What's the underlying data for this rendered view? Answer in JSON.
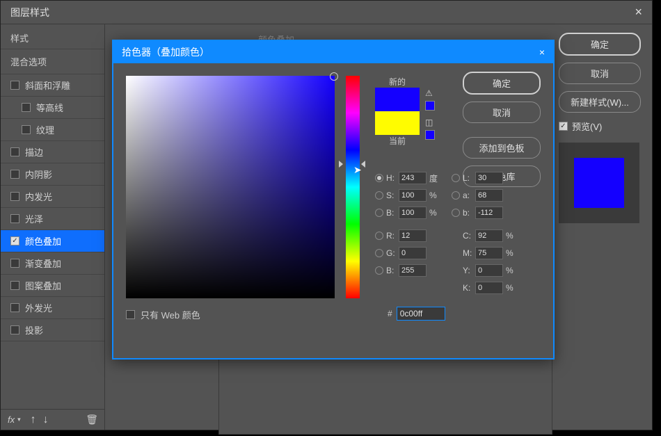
{
  "dialog": {
    "title": "图层样式"
  },
  "sidebar": {
    "head": "样式",
    "sub": "混合选项",
    "items": [
      {
        "label": "斜面和浮雕",
        "checked": false,
        "indent": false
      },
      {
        "label": "等高线",
        "checked": false,
        "indent": true
      },
      {
        "label": "纹理",
        "checked": false,
        "indent": true
      },
      {
        "label": "描边",
        "checked": false,
        "indent": false
      },
      {
        "label": "内阴影",
        "checked": false,
        "indent": false
      },
      {
        "label": "内发光",
        "checked": false,
        "indent": false
      },
      {
        "label": "光泽",
        "checked": false,
        "indent": false
      },
      {
        "label": "颜色叠加",
        "checked": true,
        "indent": false,
        "active": true
      },
      {
        "label": "渐变叠加",
        "checked": false,
        "indent": false
      },
      {
        "label": "图案叠加",
        "checked": false,
        "indent": false
      },
      {
        "label": "外发光",
        "checked": false,
        "indent": false
      },
      {
        "label": "投影",
        "checked": false,
        "indent": false
      }
    ]
  },
  "faded_header": "颜色叠加",
  "right": {
    "ok": "确定",
    "cancel": "取消",
    "newstyle": "新建样式(W)...",
    "preview": "预览(V)"
  },
  "bottom": {
    "fx": "fx"
  },
  "picker": {
    "title": "拾色器（叠加颜色）",
    "new_label": "新的",
    "cur_label": "当前",
    "ok": "确定",
    "cancel": "取消",
    "add_swatch": "添加到色板",
    "color_lib": "颜色库",
    "web_only": "只有 Web 颜色",
    "hex_label": "#",
    "hex": "0c00ff",
    "hsb": {
      "H": "243",
      "S": "100",
      "B": "100",
      "unit_deg": "度",
      "unit_pct": "%"
    },
    "lab": {
      "L": "30",
      "a": "68",
      "b": "-112"
    },
    "rgb": {
      "R": "12",
      "G": "0",
      "B": "255"
    },
    "cmyk": {
      "C": "92",
      "M": "75",
      "Y": "0",
      "K": "0",
      "unit": "%"
    },
    "colors": {
      "new": "#1400ff",
      "old": "#fffc00"
    }
  }
}
